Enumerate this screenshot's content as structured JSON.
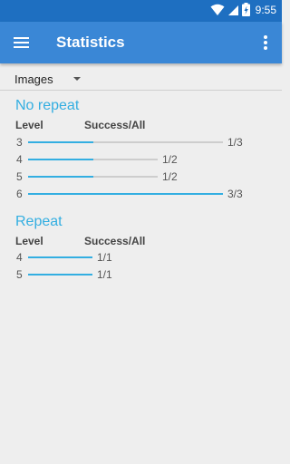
{
  "status_bar": {
    "time": "9:55",
    "icons": [
      "wifi-icon",
      "signal-icon",
      "battery-charging-icon"
    ]
  },
  "app_bar": {
    "title": "Statistics",
    "menu_icon": "hamburger-menu-icon",
    "overflow_icon": "more-vertical-icon"
  },
  "filter": {
    "selected": "Images"
  },
  "colors": {
    "accent": "#33aee1",
    "app_bar": "#3a87d6",
    "status_bar": "#1e6fc1",
    "track": "#cdcdcd"
  },
  "sections": [
    {
      "title": "No repeat",
      "col_level": "Level",
      "col_success": "Success/All",
      "rows": [
        {
          "level": "3",
          "ratio": "1/3",
          "success": 1,
          "all": 3
        },
        {
          "level": "4",
          "ratio": "1/2",
          "success": 1,
          "all": 2
        },
        {
          "level": "5",
          "ratio": "1/2",
          "success": 1,
          "all": 2
        },
        {
          "level": "6",
          "ratio": "3/3",
          "success": 3,
          "all": 3
        }
      ]
    },
    {
      "title": "Repeat",
      "col_level": "Level",
      "col_success": "Success/All",
      "rows": [
        {
          "level": "4",
          "ratio": "1/1",
          "success": 1,
          "all": 1
        },
        {
          "level": "5",
          "ratio": "1/1",
          "success": 1,
          "all": 1
        }
      ]
    }
  ]
}
